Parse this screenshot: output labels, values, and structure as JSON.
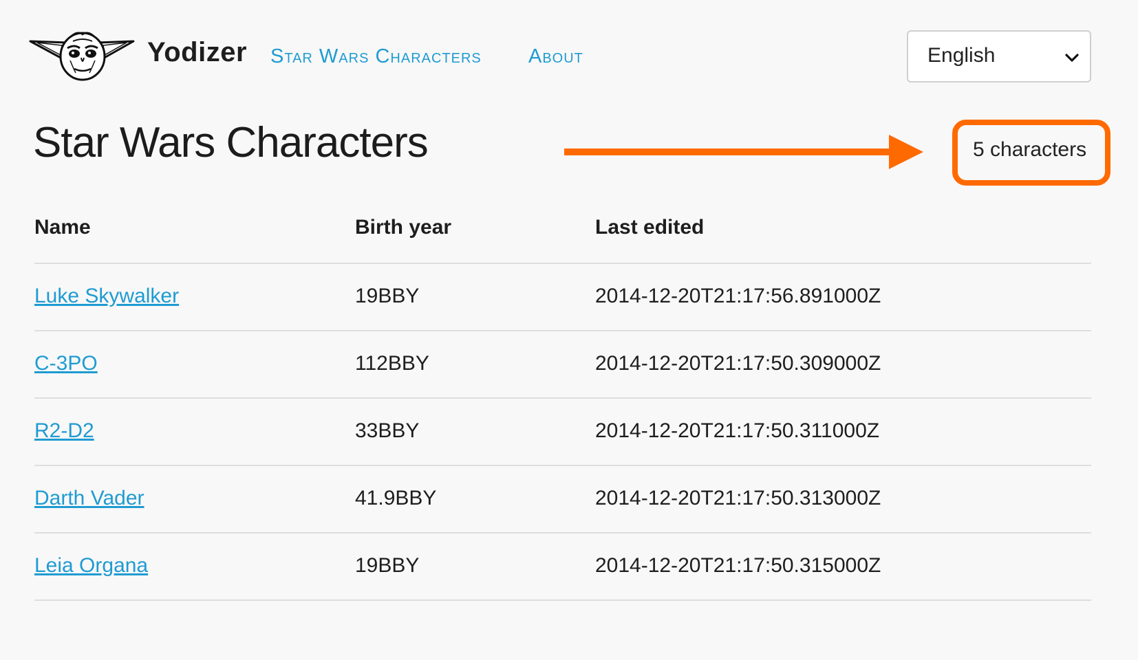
{
  "header": {
    "brand": "Yodizer",
    "logo_icon": "yoda-face-icon",
    "nav": [
      {
        "label": "Star Wars Characters"
      },
      {
        "label": "About"
      }
    ],
    "language_select": {
      "selected": "English",
      "icon": "chevron-down-icon"
    }
  },
  "main": {
    "title": "Star Wars Characters",
    "count_label": "5 characters",
    "highlight_color": "#ff6a00",
    "link_color": "#1e9bd2",
    "table": {
      "columns": [
        "Name",
        "Birth year",
        "Last edited"
      ],
      "rows": [
        {
          "name": "Luke Skywalker",
          "birth_year": "19BBY",
          "edited": "2014-12-20T21:17:56.891000Z"
        },
        {
          "name": "C-3PO",
          "birth_year": "112BBY",
          "edited": "2014-12-20T21:17:50.309000Z"
        },
        {
          "name": "R2-D2",
          "birth_year": "33BBY",
          "edited": "2014-12-20T21:17:50.311000Z"
        },
        {
          "name": "Darth Vader",
          "birth_year": "41.9BBY",
          "edited": "2014-12-20T21:17:50.313000Z"
        },
        {
          "name": "Leia Organa",
          "birth_year": "19BBY",
          "edited": "2014-12-20T21:17:50.315000Z"
        }
      ]
    }
  }
}
